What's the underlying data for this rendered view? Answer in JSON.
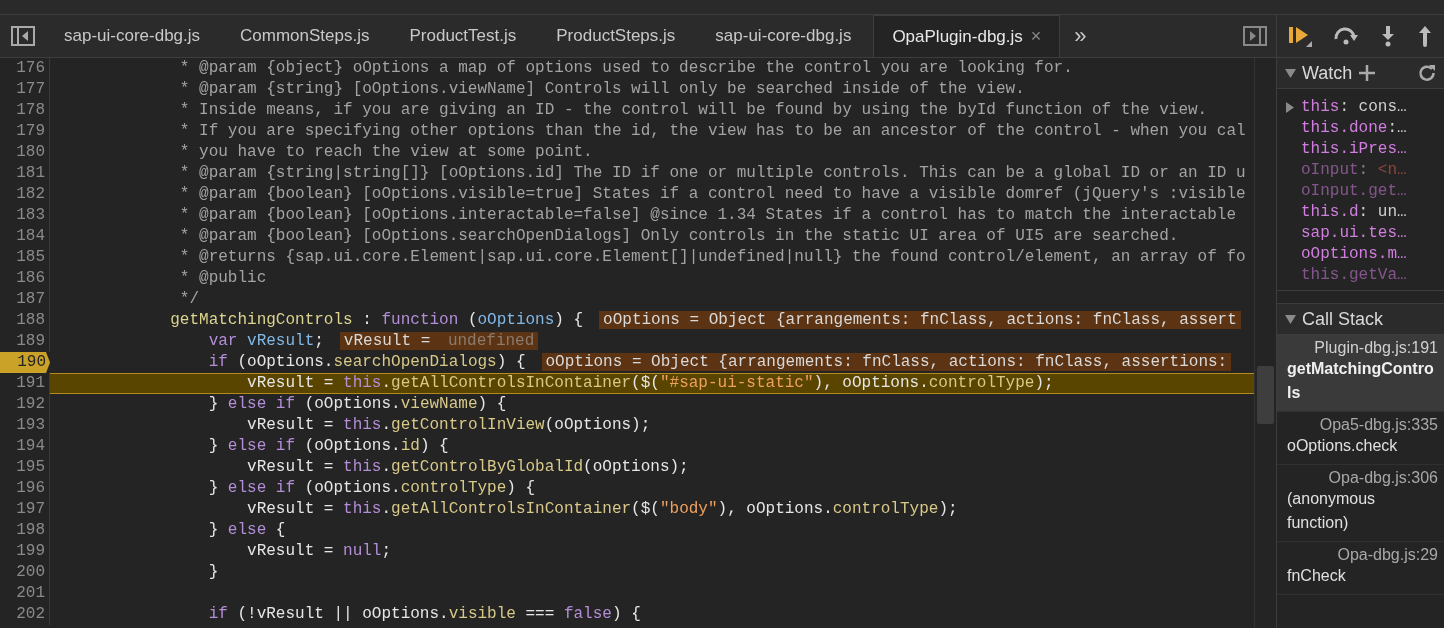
{
  "file_tabs": [
    {
      "label": "sap-ui-core-dbg.js",
      "selected": false
    },
    {
      "label": "CommonSteps.js",
      "selected": false
    },
    {
      "label": "ProductTest.js",
      "selected": false
    },
    {
      "label": "ProductSteps.js",
      "selected": false
    },
    {
      "label": "sap-ui-core-dbg.js",
      "selected": false
    },
    {
      "label": "OpaPlugin-dbg.js",
      "selected": true,
      "close": "×"
    }
  ],
  "more_tabs": "»",
  "code_lines": [
    {
      "number": "176",
      "breakpoint": false,
      "current": false,
      "segments": [
        {
          "kind": "comment",
          "text": "             * @param {object} oOptions a map of options used to describe the control you are looking for."
        }
      ]
    },
    {
      "number": "177",
      "breakpoint": false,
      "current": false,
      "segments": [
        {
          "kind": "comment",
          "text": "             * @param {string} [oOptions.viewName] Controls will only be searched inside of the view."
        }
      ]
    },
    {
      "number": "178",
      "breakpoint": false,
      "current": false,
      "segments": [
        {
          "kind": "comment",
          "text": "             * Inside means, if you are giving an ID - the control will be found by using the byId function of the view."
        }
      ]
    },
    {
      "number": "179",
      "breakpoint": false,
      "current": false,
      "segments": [
        {
          "kind": "comment",
          "text": "             * If you are specifying other options than the id, the view has to be an ancestor of the control - when you cal"
        }
      ]
    },
    {
      "number": "180",
      "breakpoint": false,
      "current": false,
      "segments": [
        {
          "kind": "comment",
          "text": "             * you have to reach the view at some point."
        }
      ]
    },
    {
      "number": "181",
      "breakpoint": false,
      "current": false,
      "segments": [
        {
          "kind": "comment",
          "text": "             * @param {string|string[]} [oOptions.id] The ID if one or multiple controls. This can be a global ID or an ID u"
        }
      ]
    },
    {
      "number": "182",
      "breakpoint": false,
      "current": false,
      "segments": [
        {
          "kind": "comment",
          "text": "             * @param {boolean} [oOptions.visible=true] States if a control need to have a visible domref (jQuery's :visible"
        }
      ]
    },
    {
      "number": "183",
      "breakpoint": false,
      "current": false,
      "segments": [
        {
          "kind": "comment",
          "text": "             * @param {boolean} [oOptions.interactable=false] @since 1.34 States if a control has to match the interactable"
        }
      ]
    },
    {
      "number": "184",
      "breakpoint": false,
      "current": false,
      "segments": [
        {
          "kind": "comment",
          "text": "             * @param {boolean} [oOptions.searchOpenDialogs] Only controls in the static UI area of UI5 are searched."
        }
      ]
    },
    {
      "number": "185",
      "breakpoint": false,
      "current": false,
      "segments": [
        {
          "kind": "comment",
          "text": "             * @returns {sap.ui.core.Element|sap.ui.core.Element[]|undefined|null} the found control/element, an array of fo"
        }
      ]
    },
    {
      "number": "186",
      "breakpoint": false,
      "current": false,
      "segments": [
        {
          "kind": "comment",
          "text": "             * @public"
        }
      ]
    },
    {
      "number": "187",
      "breakpoint": false,
      "current": false,
      "segments": [
        {
          "kind": "comment",
          "text": "             */"
        }
      ]
    },
    {
      "number": "188",
      "breakpoint": false,
      "current": false,
      "segments": [
        {
          "kind": "def",
          "text": "            getMatchingControls"
        },
        {
          "kind": "plain",
          "text": " : "
        },
        {
          "kind": "keyword",
          "text": "function"
        },
        {
          "kind": "plain",
          "text": " ("
        },
        {
          "kind": "param",
          "text": "oOptions"
        },
        {
          "kind": "plain",
          "text": ") {"
        },
        {
          "kind": "inline",
          "text": "oOptions = Object {arrangements: fnClass, actions: fnClass, assert"
        }
      ]
    },
    {
      "number": "189",
      "breakpoint": false,
      "current": false,
      "segments": [
        {
          "kind": "keyword",
          "text": "                var "
        },
        {
          "kind": "param",
          "text": "vResult"
        },
        {
          "kind": "plain",
          "text": ";"
        },
        {
          "kind": "inline",
          "text": "vResult = "
        },
        {
          "kind": "inline-undefined",
          "text": "undefined"
        }
      ]
    },
    {
      "number": "190",
      "breakpoint": true,
      "current": false,
      "segments": [
        {
          "kind": "keyword",
          "text": "                if"
        },
        {
          "kind": "plain",
          "text": " (oOptions."
        },
        {
          "kind": "prop",
          "text": "searchOpenDialogs"
        },
        {
          "kind": "plain",
          "text": ") {"
        },
        {
          "kind": "inline",
          "text": "oOptions = Object {arrangements: fnClass, actions: fnClass, assertions:"
        }
      ]
    },
    {
      "number": "191",
      "breakpoint": false,
      "current": true,
      "segments": [
        {
          "kind": "plain",
          "text": "                    vResult = "
        },
        {
          "kind": "keyword",
          "text": "this"
        },
        {
          "kind": "plain",
          "text": "."
        },
        {
          "kind": "prop",
          "text": "getAllControlsInContainer"
        },
        {
          "kind": "plain",
          "text": "($("
        },
        {
          "kind": "string",
          "text": "\"#sap-ui-static\""
        },
        {
          "kind": "plain",
          "text": "), oOptions."
        },
        {
          "kind": "prop",
          "text": "controlType"
        },
        {
          "kind": "plain",
          "text": ");"
        }
      ]
    },
    {
      "number": "192",
      "breakpoint": false,
      "current": false,
      "segments": [
        {
          "kind": "plain",
          "text": "                } "
        },
        {
          "kind": "keyword",
          "text": "else if"
        },
        {
          "kind": "plain",
          "text": " (oOptions."
        },
        {
          "kind": "prop",
          "text": "viewName"
        },
        {
          "kind": "plain",
          "text": ") {"
        }
      ]
    },
    {
      "number": "193",
      "breakpoint": false,
      "current": false,
      "segments": [
        {
          "kind": "plain",
          "text": "                    vResult = "
        },
        {
          "kind": "keyword",
          "text": "this"
        },
        {
          "kind": "plain",
          "text": "."
        },
        {
          "kind": "prop",
          "text": "getControlInView"
        },
        {
          "kind": "plain",
          "text": "(oOptions);"
        }
      ]
    },
    {
      "number": "194",
      "breakpoint": false,
      "current": false,
      "segments": [
        {
          "kind": "plain",
          "text": "                } "
        },
        {
          "kind": "keyword",
          "text": "else if"
        },
        {
          "kind": "plain",
          "text": " (oOptions."
        },
        {
          "kind": "prop",
          "text": "id"
        },
        {
          "kind": "plain",
          "text": ") {"
        }
      ]
    },
    {
      "number": "195",
      "breakpoint": false,
      "current": false,
      "segments": [
        {
          "kind": "plain",
          "text": "                    vResult = "
        },
        {
          "kind": "keyword",
          "text": "this"
        },
        {
          "kind": "plain",
          "text": "."
        },
        {
          "kind": "prop",
          "text": "getControlByGlobalId"
        },
        {
          "kind": "plain",
          "text": "(oOptions);"
        }
      ]
    },
    {
      "number": "196",
      "breakpoint": false,
      "current": false,
      "segments": [
        {
          "kind": "plain",
          "text": "                } "
        },
        {
          "kind": "keyword",
          "text": "else if"
        },
        {
          "kind": "plain",
          "text": " (oOptions."
        },
        {
          "kind": "prop",
          "text": "controlType"
        },
        {
          "kind": "plain",
          "text": ") {"
        }
      ]
    },
    {
      "number": "197",
      "breakpoint": false,
      "current": false,
      "segments": [
        {
          "kind": "plain",
          "text": "                    vResult = "
        },
        {
          "kind": "keyword",
          "text": "this"
        },
        {
          "kind": "plain",
          "text": "."
        },
        {
          "kind": "prop",
          "text": "getAllControlsInContainer"
        },
        {
          "kind": "plain",
          "text": "($("
        },
        {
          "kind": "string",
          "text": "\"body\""
        },
        {
          "kind": "plain",
          "text": "), oOptions."
        },
        {
          "kind": "prop",
          "text": "controlType"
        },
        {
          "kind": "plain",
          "text": ");"
        }
      ]
    },
    {
      "number": "198",
      "breakpoint": false,
      "current": false,
      "segments": [
        {
          "kind": "plain",
          "text": "                } "
        },
        {
          "kind": "keyword",
          "text": "else"
        },
        {
          "kind": "plain",
          "text": " {"
        }
      ]
    },
    {
      "number": "199",
      "breakpoint": false,
      "current": false,
      "segments": [
        {
          "kind": "plain",
          "text": "                    vResult = "
        },
        {
          "kind": "keyword",
          "text": "null"
        },
        {
          "kind": "plain",
          "text": ";"
        }
      ]
    },
    {
      "number": "200",
      "breakpoint": false,
      "current": false,
      "segments": [
        {
          "kind": "plain",
          "text": "                }"
        }
      ]
    },
    {
      "number": "201",
      "breakpoint": false,
      "current": false
    },
    {
      "number": "202",
      "breakpoint": false,
      "current": false,
      "segments": [
        {
          "kind": "keyword",
          "text": "                if"
        },
        {
          "kind": "plain",
          "text": " (!vResult || oOptions."
        },
        {
          "kind": "prop",
          "text": "visible"
        },
        {
          "kind": "plain",
          "text": " === "
        },
        {
          "kind": "keyword",
          "text": "false"
        },
        {
          "kind": "plain",
          "text": ") {"
        }
      ]
    }
  ],
  "watch": {
    "title": "Watch",
    "expanded": true,
    "items": [
      {
        "expandable": true,
        "dimmed": false,
        "segments": [
          {
            "kind": "name",
            "text": "this"
          },
          {
            "kind": "punct",
            "text": ": cons…"
          }
        ]
      },
      {
        "expandable": false,
        "dimmed": false,
        "segments": [
          {
            "kind": "name",
            "text": "this.done"
          },
          {
            "kind": "punct",
            "text": ":…"
          }
        ]
      },
      {
        "expandable": false,
        "dimmed": false,
        "segments": [
          {
            "kind": "name",
            "text": "this.iPres…"
          }
        ]
      },
      {
        "expandable": false,
        "dimmed": true,
        "segments": [
          {
            "kind": "name",
            "text": "oInput"
          },
          {
            "kind": "punct",
            "text": ": "
          },
          {
            "kind": "error",
            "text": "<n…"
          }
        ]
      },
      {
        "expandable": false,
        "dimmed": true,
        "segments": [
          {
            "kind": "name",
            "text": "oInput.get…"
          }
        ]
      },
      {
        "expandable": false,
        "dimmed": false,
        "segments": [
          {
            "kind": "name",
            "text": "this.d"
          },
          {
            "kind": "punct",
            "text": ": un…"
          }
        ]
      },
      {
        "expandable": false,
        "dimmed": false,
        "segments": [
          {
            "kind": "name",
            "text": "sap.ui.tes…"
          }
        ]
      },
      {
        "expandable": false,
        "dimmed": false,
        "segments": [
          {
            "kind": "name",
            "text": "oOptions.m…"
          }
        ]
      },
      {
        "expandable": false,
        "dimmed": true,
        "segments": [
          {
            "kind": "name",
            "text": "this.getVa…"
          }
        ]
      }
    ]
  },
  "call_stack": {
    "title": "Call Stack",
    "expanded": true,
    "frames": [
      {
        "location": "Plugin-dbg.js:191",
        "function": "getMatchingControls",
        "selected": true
      },
      {
        "location": "Opa5-dbg.js:335",
        "function": "oOptions.check",
        "selected": false
      },
      {
        "location": "Opa-dbg.js:306",
        "function": "(anonymous function)",
        "selected": false
      },
      {
        "location": "Opa-dbg.js:29",
        "function": "fnCheck",
        "selected": false
      }
    ]
  }
}
